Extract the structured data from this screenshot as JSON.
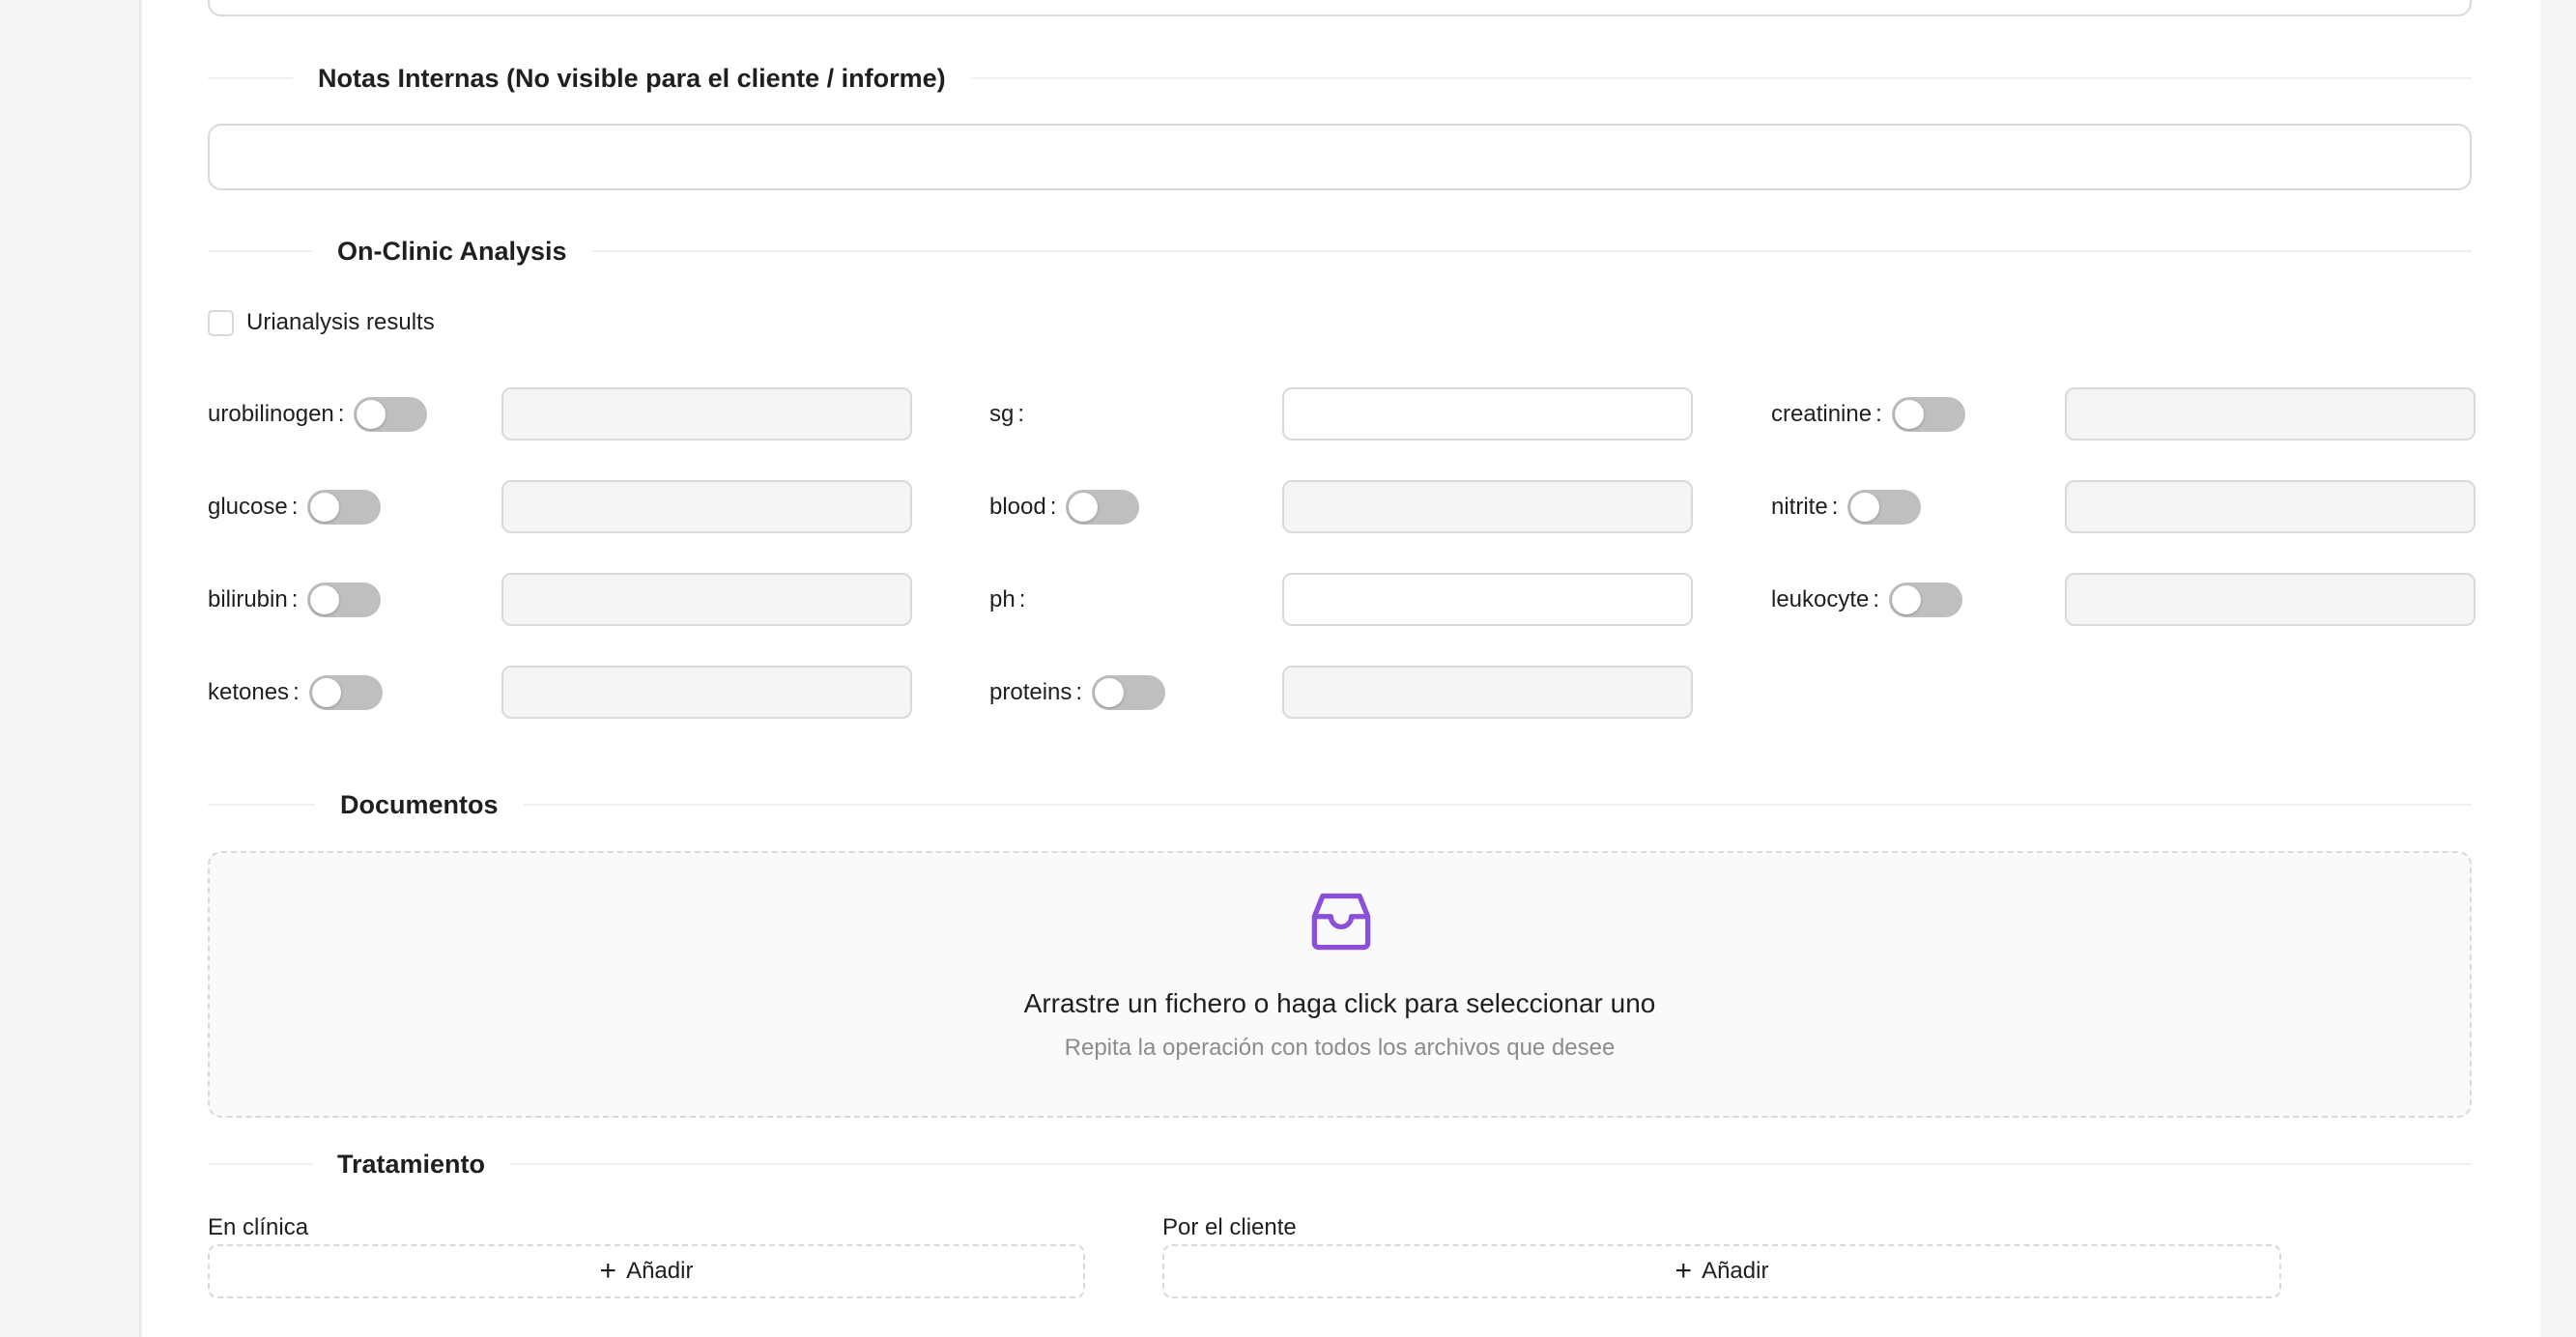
{
  "sections": {
    "notes": {
      "title": "Notas Internas (No visible para el cliente / informe)"
    },
    "analysis": {
      "title": "On-Clinic Analysis"
    },
    "documents": {
      "title": "Documentos"
    },
    "treatment": {
      "title": "Tratamiento"
    }
  },
  "urianalysis": {
    "checkbox_label": "Urianalysis results",
    "checked": false
  },
  "fields": {
    "urobilinogen": {
      "label": "urobilinogen",
      "toggle": false
    },
    "sg": {
      "label": "sg"
    },
    "creatinine": {
      "label": "creatinine",
      "toggle": false
    },
    "glucose": {
      "label": "glucose",
      "toggle": false
    },
    "blood": {
      "label": "blood",
      "toggle": false
    },
    "nitrite": {
      "label": "nitrite",
      "toggle": false
    },
    "bilirubin": {
      "label": "bilirubin",
      "toggle": false
    },
    "ph": {
      "label": "ph"
    },
    "leukocyte": {
      "label": "leukocyte",
      "toggle": false
    },
    "ketones": {
      "label": "ketones",
      "toggle": false
    },
    "proteins": {
      "label": "proteins",
      "toggle": false
    },
    "colon": ":"
  },
  "dropzone": {
    "title": "Arrastre un fichero o haga click para seleccionar uno",
    "subtitle": "Repita la operación con todos los archivos que desee",
    "icon": "inbox-icon"
  },
  "treatment": {
    "in_clinic_label": "En clínica",
    "by_client_label": "Por el cliente",
    "add_label": "Añadir"
  },
  "colors": {
    "accent": "#8c4fd9",
    "border": "#d9d9d9",
    "toggle_off": "#bfbfbf"
  }
}
